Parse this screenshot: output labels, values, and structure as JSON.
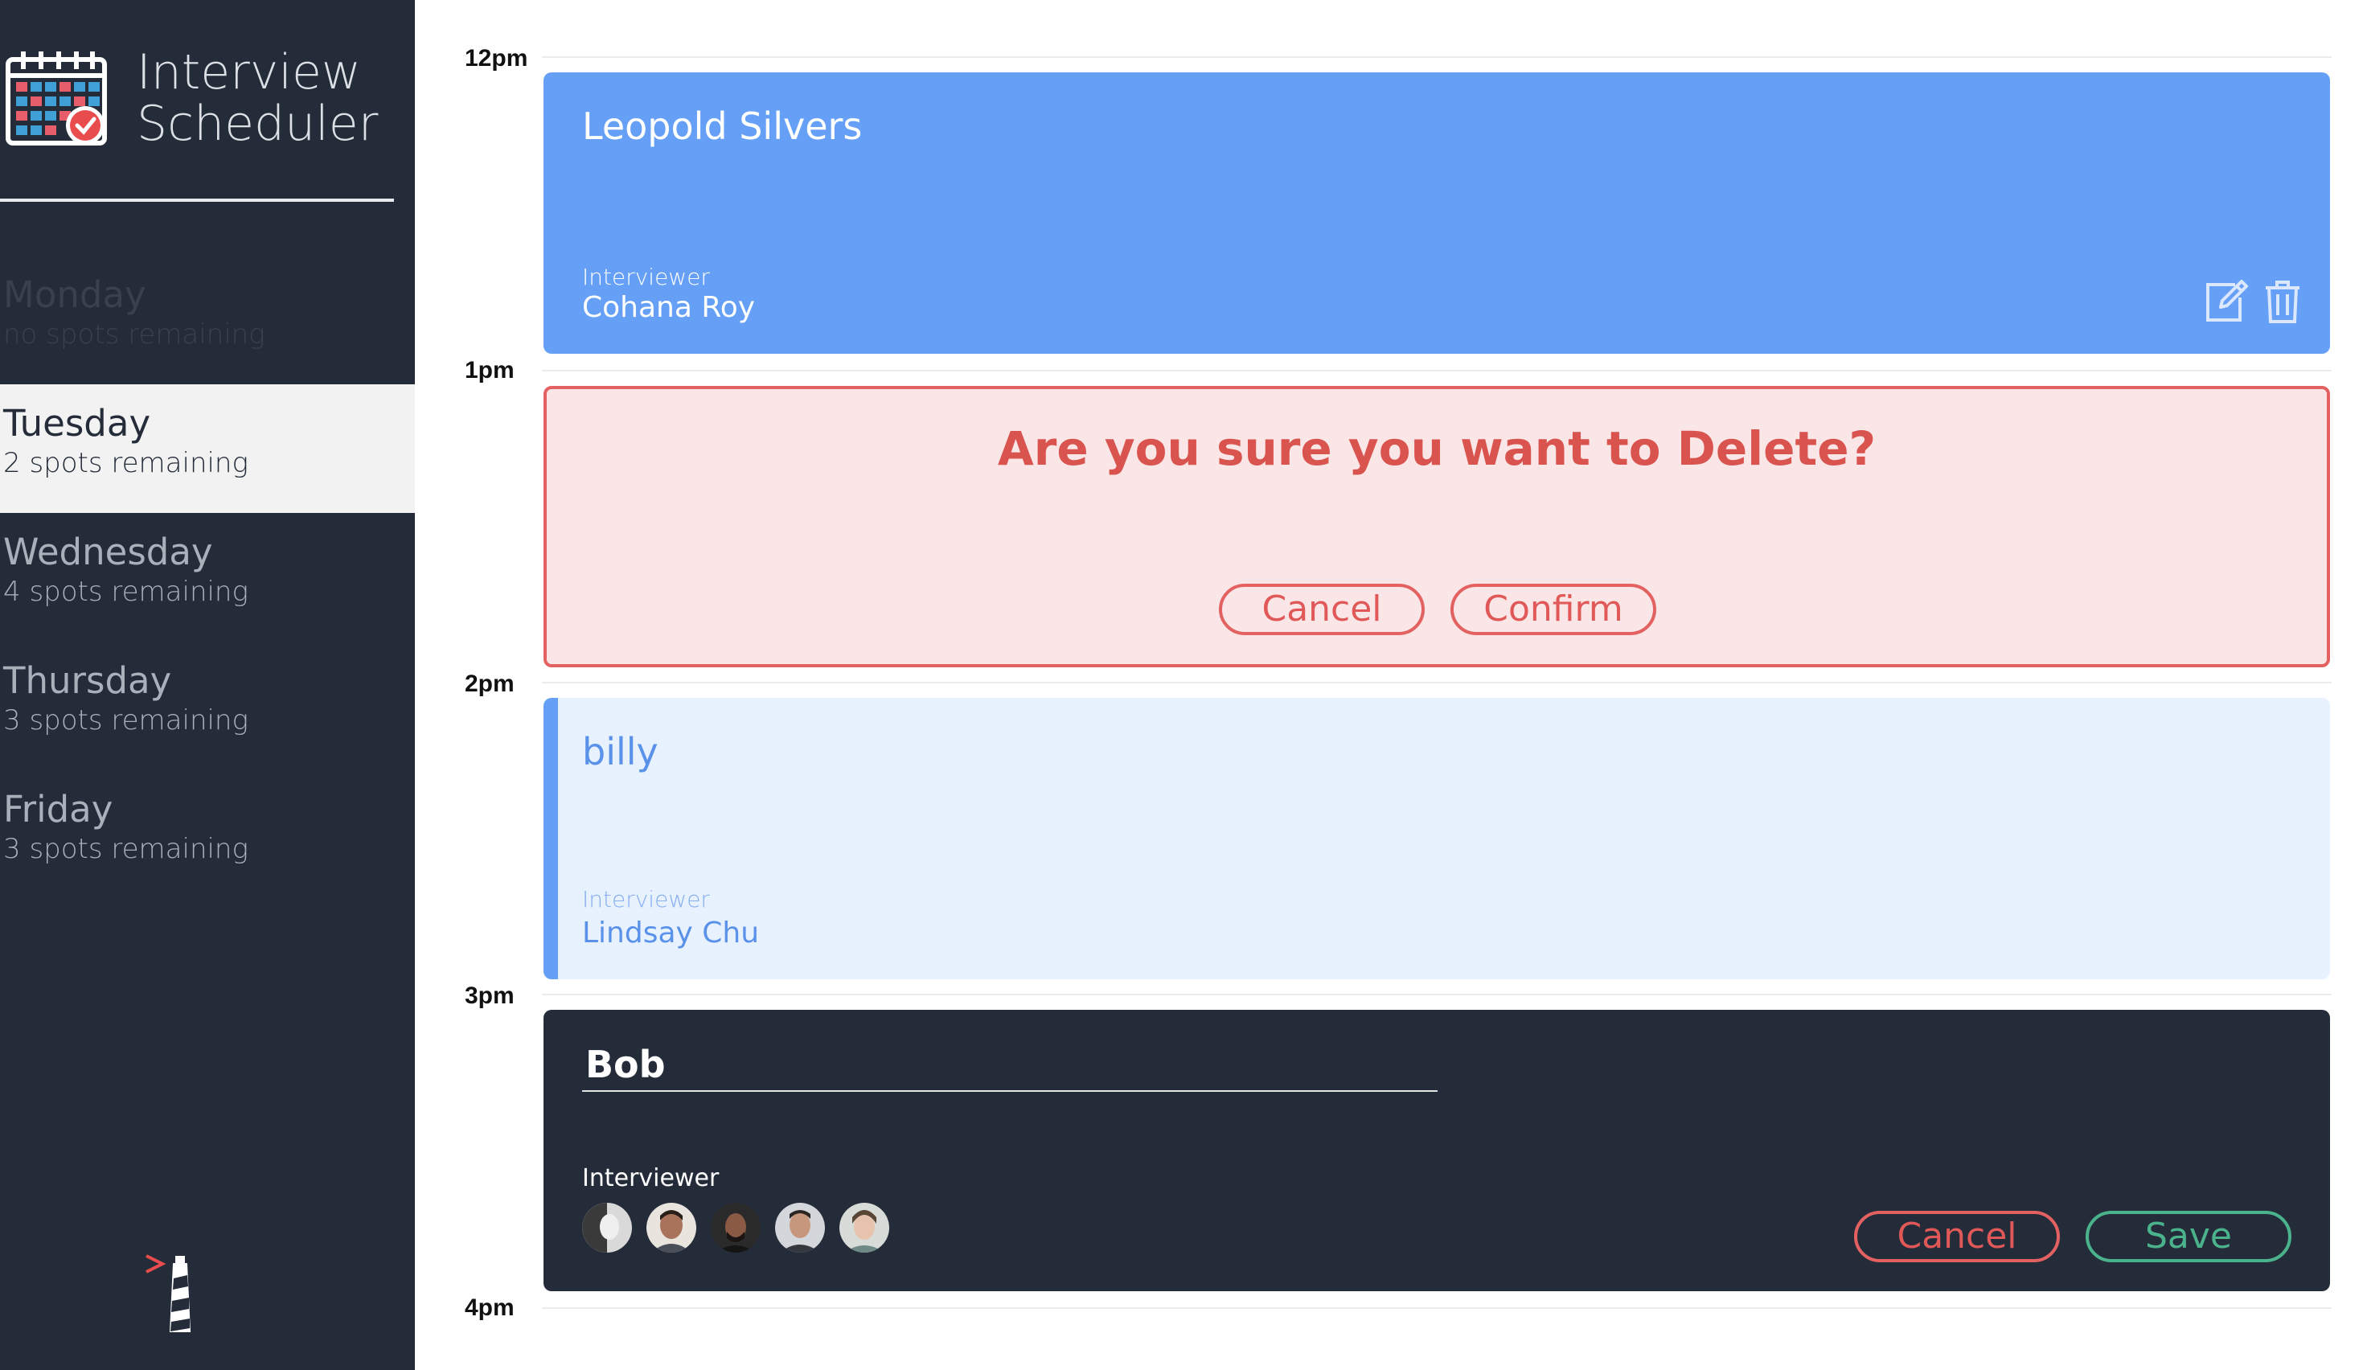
{
  "app": {
    "title_line1": "Interview",
    "title_line2": "Scheduler"
  },
  "sidebar": {
    "days": [
      {
        "name": "Monday",
        "spots": "no spots remaining",
        "state": "full"
      },
      {
        "name": "Tuesday",
        "spots": "2 spots remaining",
        "state": "selected"
      },
      {
        "name": "Wednesday",
        "spots": "4 spots remaining",
        "state": "normal"
      },
      {
        "name": "Thursday",
        "spots": "3 spots remaining",
        "state": "normal"
      },
      {
        "name": "Friday",
        "spots": "3 spots remaining",
        "state": "normal"
      }
    ]
  },
  "schedule": {
    "times": [
      "12pm",
      "1pm",
      "2pm",
      "3pm",
      "4pm"
    ],
    "appointments": [
      {
        "mode": "show",
        "student": "Leopold Silvers",
        "interviewer_label": "Interviewer",
        "interviewer": "Cohana Roy"
      },
      {
        "mode": "confirm",
        "message": "Are you sure you want to Delete?",
        "cancel_label": "Cancel",
        "confirm_label": "Confirm"
      },
      {
        "mode": "show-empty",
        "student": "billy",
        "interviewer_label": "Interviewer",
        "interviewer": "Lindsay Chu"
      },
      {
        "mode": "form",
        "student_value": "Bob",
        "interviewer_label": "Interviewer",
        "avatar_count": 5,
        "cancel_label": "Cancel",
        "save_label": "Save"
      }
    ]
  },
  "colors": {
    "sidebar_bg": "#242c3a",
    "selected_day_bg": "#f2f2f2",
    "show_card": "#66a0f6",
    "confirm_bg": "#fae6e6",
    "danger": "#e36161",
    "empty_card": "#e8f1fe",
    "success": "#4ab38c"
  },
  "icons": {
    "logo": "calendar-icon",
    "edit": "edit-icon",
    "delete": "trash-icon",
    "footer": "lighthouse-icon"
  }
}
